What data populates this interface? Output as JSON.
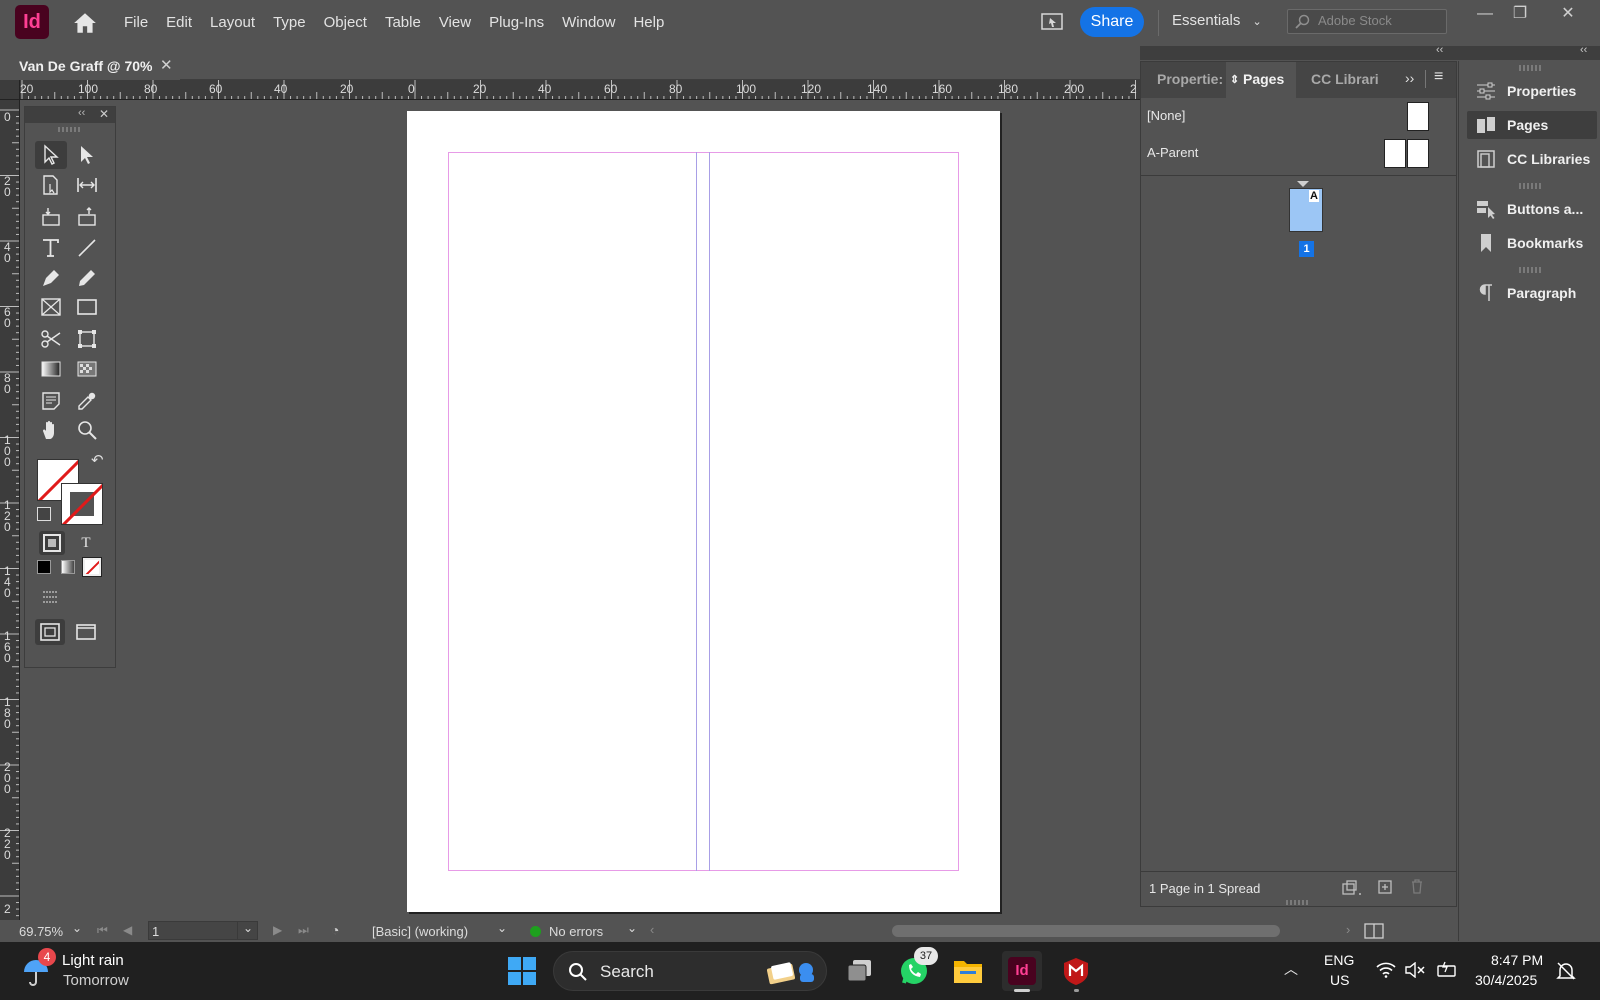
{
  "app": {
    "logo_text": "Id",
    "menu": [
      "File",
      "Edit",
      "Layout",
      "Type",
      "Object",
      "Table",
      "View",
      "Plug-Ins",
      "Window",
      "Help"
    ],
    "share_label": "Share",
    "workspace": "Essentials",
    "search_placeholder": "Adobe Stock",
    "accent_color": "#1473e6"
  },
  "document": {
    "tab_title": "Van De Graff @ 70%",
    "close_glyph": "✕"
  },
  "rulers": {
    "horizontal": [
      "20",
      "100",
      "80",
      "60",
      "40",
      "20",
      "0",
      "20",
      "40",
      "60",
      "80",
      "100",
      "120",
      "140",
      "160",
      "180",
      "200",
      "2"
    ],
    "vertical": [
      "0",
      "20",
      "40",
      "60",
      "80",
      "100",
      "120",
      "140",
      "160",
      "180",
      "200",
      "220",
      "2"
    ]
  },
  "status": {
    "zoom": "69.75%",
    "page_field": "1",
    "preflight_profile": "[Basic] (working)",
    "errors": "No errors",
    "error_status_color": "#1ea01e"
  },
  "pages_panel": {
    "tabs": [
      "Propertie:",
      "Pages",
      "CC Librari"
    ],
    "parents": [
      {
        "name": "[None]"
      },
      {
        "name": "A-Parent"
      }
    ],
    "page_thumb_prefix": "A",
    "page_number": "1",
    "summary": "1 Page in 1 Spread"
  },
  "side_panels": [
    "Properties",
    "Pages",
    "CC Libraries",
    "Buttons a...",
    "Bookmarks",
    "Paragraph"
  ],
  "taskbar": {
    "weather_badge": "4",
    "weather_title": "Light rain",
    "weather_sub": "Tomorrow",
    "search_label": "Search",
    "whatsapp_badge": "37",
    "indesign_label": "Id",
    "lang_top": "ENG",
    "lang_bottom": "US",
    "time": "8:47 PM",
    "date": "30/4/2025"
  }
}
